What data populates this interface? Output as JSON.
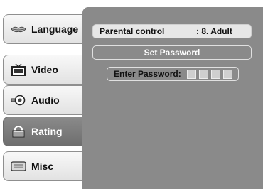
{
  "tabs": [
    {
      "label": "Language",
      "icon": "lips-icon",
      "active": false
    },
    {
      "label": "Video",
      "icon": "tv-icon",
      "active": false
    },
    {
      "label": "Audio",
      "icon": "speaker-icon",
      "active": false
    },
    {
      "label": "Rating",
      "icon": "lock-icon",
      "active": true
    },
    {
      "label": "Misc",
      "icon": "keyboard-icon",
      "active": false
    }
  ],
  "settings": {
    "parental_label": "Parental control",
    "parental_value": ": 8. Adult",
    "set_password": "Set Password",
    "enter_password": "Enter Password:",
    "password_slots": 4
  },
  "colors": {
    "panel": "#8a8a8a",
    "active_tab": "#7b7b7b"
  }
}
